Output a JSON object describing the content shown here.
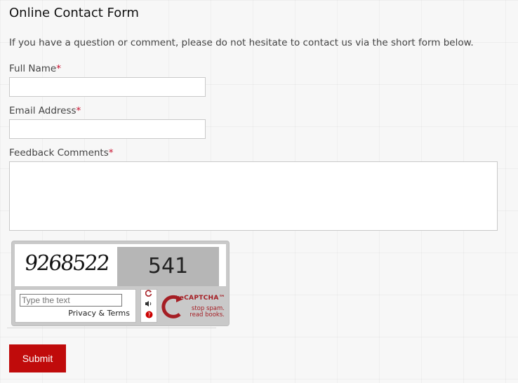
{
  "form": {
    "title": "Online Contact Form",
    "intro": "If you have a question or comment, please do not hesitate to contact us via the short form below.",
    "required_marker": "*",
    "fields": {
      "full_name": {
        "label": "Full Name",
        "value": ""
      },
      "email": {
        "label": "Email Address",
        "value": ""
      },
      "comments": {
        "label": "Feedback Comments",
        "value": ""
      }
    },
    "submit_label": "Submit"
  },
  "captcha": {
    "challenge_word_1": "9268522",
    "challenge_word_2": "541",
    "input_placeholder": "Type the text",
    "privacy_terms": "Privacy & Terms",
    "refresh_icon": "refresh-icon",
    "audio_icon": "audio-icon",
    "help_icon": "help-icon",
    "logo_text": "reCAPTCHA™",
    "logo_tagline_1": "stop spam.",
    "logo_tagline_2": "read books.",
    "brand_color": "#a51e24"
  },
  "colors": {
    "accent": "#c00b0b",
    "required": "#c8102e"
  }
}
